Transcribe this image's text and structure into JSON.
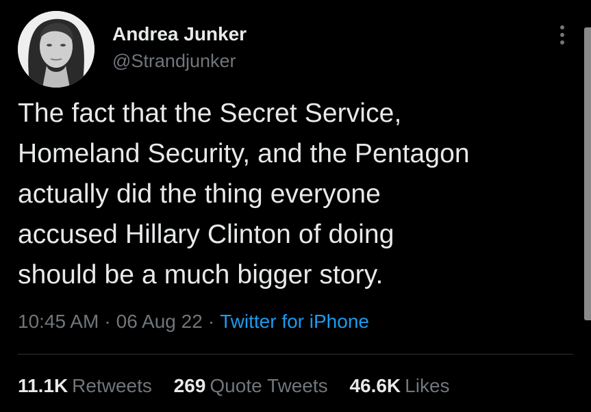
{
  "tweet": {
    "author": {
      "display_name": "Andrea Junker",
      "handle": "@Strandjunker",
      "avatar_icon": "profile-photo"
    },
    "more_icon": "more-vertical-icon",
    "text_lines": [
      "The fact that the Secret Service,",
      "Homeland Security, and the Pentagon",
      "actually did the thing everyone",
      "accused Hillary Clinton of doing",
      "should be a much bigger story."
    ],
    "time": "10:45 AM",
    "date": "06 Aug 22",
    "separator": "·",
    "source": "Twitter for iPhone",
    "stats": {
      "retweets": {
        "count": "11.1K",
        "label": "Retweets"
      },
      "quote_tweets": {
        "count": "269",
        "label": "Quote Tweets"
      },
      "likes": {
        "count": "46.6K",
        "label": "Likes"
      }
    }
  },
  "colors": {
    "background": "#000000",
    "primary_text": "#e7e9ea",
    "secondary_text": "#71767b",
    "link": "#1d9bf0",
    "divider": "#2f3336"
  }
}
